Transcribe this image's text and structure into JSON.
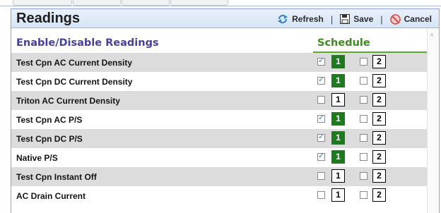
{
  "panel": {
    "title": "Readings",
    "toolbar": {
      "refresh_label": "Refresh",
      "save_label": "Save",
      "cancel_label": "Cancel",
      "separator": "|"
    },
    "columns": {
      "left": "Enable/Disable Readings",
      "right": "Schedule"
    },
    "rows": [
      {
        "label": "Test Cpn AC Current Density",
        "sched1_checked": true,
        "sched1": "1",
        "sched2_checked": false,
        "sched2": "2"
      },
      {
        "label": "Test Cpn DC Current Density",
        "sched1_checked": true,
        "sched1": "1",
        "sched2_checked": false,
        "sched2": "2"
      },
      {
        "label": "Triton AC Current Density",
        "sched1_checked": false,
        "sched1": "1",
        "sched2_checked": false,
        "sched2": "2"
      },
      {
        "label": "Test Cpn AC P/S",
        "sched1_checked": true,
        "sched1": "1",
        "sched2_checked": false,
        "sched2": "2"
      },
      {
        "label": "Test Cpn DC P/S",
        "sched1_checked": true,
        "sched1": "1",
        "sched2_checked": false,
        "sched2": "2"
      },
      {
        "label": "Native P/S",
        "sched1_checked": true,
        "sched1": "1",
        "sched2_checked": false,
        "sched2": "2"
      },
      {
        "label": "Test Cpn Instant Off",
        "sched1_checked": false,
        "sched1": "1",
        "sched2_checked": false,
        "sched2": "2"
      },
      {
        "label": "AC Drain Current",
        "sched1_checked": false,
        "sched1": "1",
        "sched2_checked": false,
        "sched2": "2"
      }
    ]
  },
  "colors": {
    "schedule_active": "#1f7a1f",
    "left_header": "#46419a",
    "right_header": "#3f8a1f",
    "cancel_icon": "#d24a4a",
    "refresh_icon": "#3a86c8"
  },
  "icons": {
    "refresh": "refresh-icon",
    "save": "save-icon",
    "cancel": "cancel-icon",
    "check": "check-icon",
    "scroll_up": "scroll-up-icon"
  }
}
